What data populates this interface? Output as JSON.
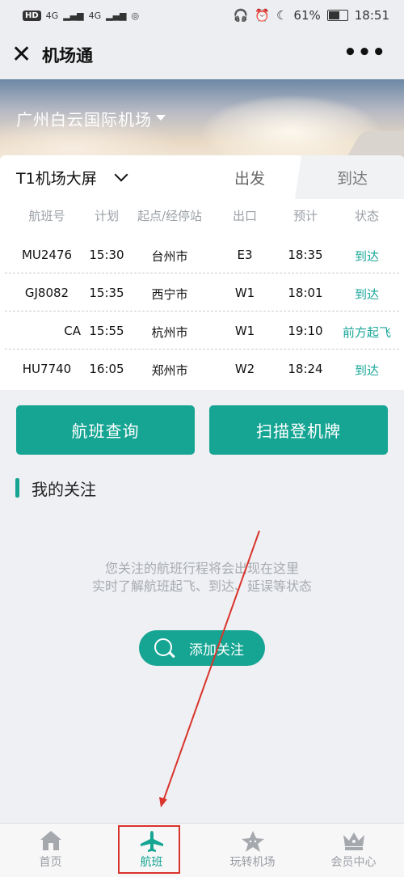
{
  "status_bar": {
    "left_badges": [
      "HD",
      "4G",
      "4G"
    ],
    "battery_percent": "61%",
    "time": "18:51"
  },
  "navbar": {
    "title": "机场通",
    "more": "•••"
  },
  "banner": {
    "airport": "广州白云国际机场"
  },
  "board": {
    "selector": "T1机场大屏",
    "tab_departure": "出发",
    "tab_arrival": "到达",
    "active_tab": "到达",
    "columns": [
      "航班号",
      "计划",
      "起点/经停站",
      "出口",
      "预计",
      "状态"
    ],
    "rows": [
      {
        "flight": "MU2476",
        "plan": "15:30",
        "origin": "台州市",
        "exit": "E3",
        "eta": "18:35",
        "status": "到达"
      },
      {
        "flight": "GJ8082",
        "plan": "15:35",
        "origin": "西宁市",
        "exit": "W1",
        "eta": "18:01",
        "status": "到达"
      },
      {
        "flight": "CA",
        "plan": "15:55",
        "origin": "杭州市",
        "exit": "W1",
        "eta": "19:10",
        "status": "前方起飞"
      },
      {
        "flight": "HU7740",
        "plan": "16:05",
        "origin": "郑州市",
        "exit": "W2",
        "eta": "18:24",
        "status": "到达"
      }
    ]
  },
  "actions": {
    "query": "航班查询",
    "scan": "扫描登机牌"
  },
  "follow": {
    "title": "我的关注",
    "empty_line1": "您关注的航班行程将会出现在这里",
    "empty_line2": "实时了解航班起飞、到达、延误等状态",
    "add_button": "添加关注"
  },
  "tabbar": {
    "items": [
      {
        "label": "首页",
        "icon": "home-icon"
      },
      {
        "label": "航班",
        "icon": "airplane-icon",
        "active": true
      },
      {
        "label": "玩转机场",
        "icon": "star-icon"
      },
      {
        "label": "会员中心",
        "icon": "crown-icon"
      }
    ]
  },
  "colors": {
    "accent": "#16a593",
    "annotation": "#d9342b"
  }
}
